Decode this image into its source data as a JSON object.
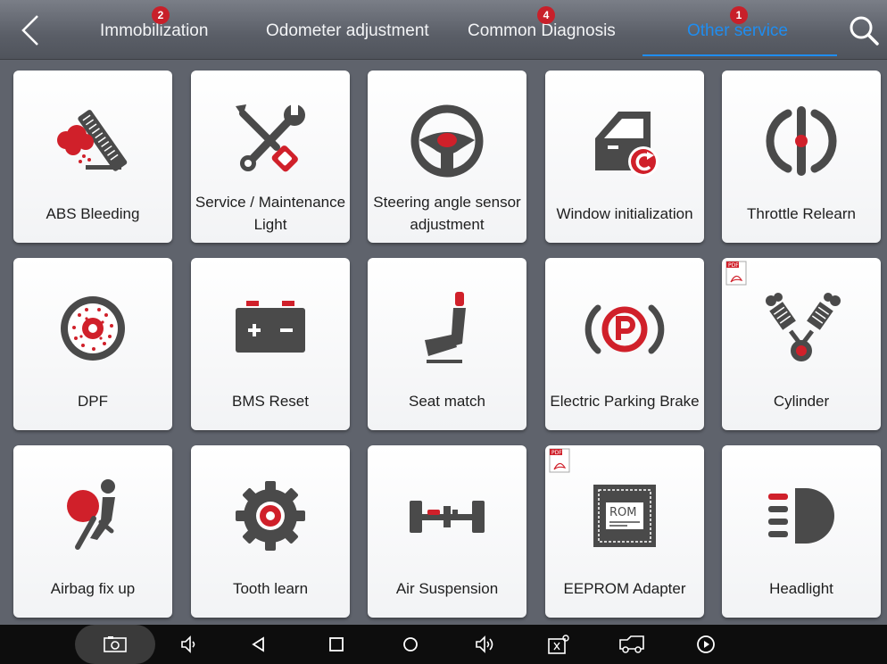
{
  "header": {
    "tabs": [
      {
        "label": "Immobilization",
        "badge": "2",
        "active": false
      },
      {
        "label": "Odometer adjustment",
        "badge": "",
        "active": false
      },
      {
        "label": "Common Diagnosis",
        "badge": "4",
        "active": false
      },
      {
        "label": "Other service",
        "badge": "1",
        "active": true
      }
    ]
  },
  "tiles": [
    {
      "label": "ABS Bleeding",
      "icon": "abs-bleeding-icon"
    },
    {
      "label": "Service / Maintenance Light",
      "icon": "wrench-screwdriver-icon"
    },
    {
      "label": "Steering angle sensor adjustment",
      "icon": "steering-wheel-icon"
    },
    {
      "label": "Window initialization",
      "icon": "car-door-icon"
    },
    {
      "label": "Throttle Relearn",
      "icon": "throttle-icon"
    },
    {
      "label": "DPF",
      "icon": "dpf-filter-icon"
    },
    {
      "label": "BMS Reset",
      "icon": "battery-icon"
    },
    {
      "label": "Seat match",
      "icon": "seat-icon"
    },
    {
      "label": "Electric Parking Brake",
      "icon": "parking-brake-icon"
    },
    {
      "label": "Cylinder",
      "icon": "cylinder-icon"
    },
    {
      "label": "Airbag fix up",
      "icon": "airbag-icon"
    },
    {
      "label": "Tooth learn",
      "icon": "gear-icon"
    },
    {
      "label": "Air Suspension",
      "icon": "axle-icon"
    },
    {
      "label": "EEPROM Adapter",
      "icon": "rom-chip-icon"
    },
    {
      "label": "Headlight",
      "icon": "headlight-icon"
    }
  ],
  "tile_icon_texts": {
    "rom_chip": "ROM",
    "pdf_badge": "PDF"
  },
  "colors": {
    "accent": "#1f8df0",
    "brand_red": "#d0202a",
    "icon_dark": "#4a4a4a",
    "badge": "#c8202a"
  },
  "navbar": [
    "screenshot-icon",
    "volume-down-icon",
    "back-icon",
    "recent-apps-icon",
    "home-icon",
    "volume-up-icon",
    "vci-icon",
    "truck-icon",
    "play-icon"
  ]
}
